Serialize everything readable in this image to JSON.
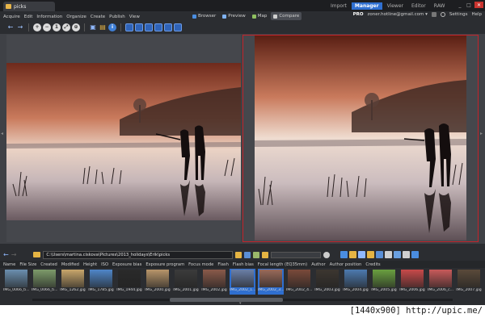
{
  "window": {
    "doc_tab": "picks",
    "modes": [
      "Import",
      "Manager",
      "Viewer",
      "Editor",
      "RAW"
    ],
    "active_mode": "Manager",
    "buttons": {
      "minimize": "_",
      "maximize": "□",
      "close": "✕"
    }
  },
  "menu": [
    "Acquire",
    "Edit",
    "Information",
    "Organize",
    "Create",
    "Publish",
    "View"
  ],
  "view_buttons": [
    {
      "label": "Browser",
      "icon": "browser-icon"
    },
    {
      "label": "Preview",
      "icon": "preview-icon"
    },
    {
      "label": "Map",
      "icon": "map-icon"
    },
    {
      "label": "Compare",
      "icon": "compare-icon",
      "active": true
    }
  ],
  "account": {
    "pro": "PRO",
    "email": "zoner.hotline@gmail.com ▾",
    "settings": "Settings",
    "help": "Help"
  },
  "path": {
    "current": "C:\\Users\\martina.ciskova\\Pictures\\2013_holidays\\Erik\\picks"
  },
  "columns": [
    "Name",
    "File Size",
    "Created",
    "Modified",
    "Height",
    "ISO",
    "Exposure bias",
    "Exposure program",
    "Focus mode",
    "Flash",
    "Flash bias",
    "Focal length (EQ35mm)",
    "Author",
    "Author position",
    "Credits"
  ],
  "thumbnails": [
    {
      "label": "IMG_0066_ti...",
      "color": "#6b8fb0"
    },
    {
      "label": "IMG_0066_ti...",
      "color": "#7d9b6a"
    },
    {
      "label": "IMG_1262.jpg",
      "color": "#c9a66b"
    },
    {
      "label": "IMG_1785.jpg",
      "color": "#4f86c9"
    },
    {
      "label": "IMG_1944.jpg",
      "color": "#2a2a2a"
    },
    {
      "label": "IMG_2000.jpg",
      "color": "#b8956a"
    },
    {
      "label": "IMG_2001.jpg",
      "color": "#3b3b3b"
    },
    {
      "label": "IMG_2002.jpg",
      "color": "#8a5a4a"
    },
    {
      "label": "IMG_2002_1...",
      "color": "#6a7fa8",
      "selected": true
    },
    {
      "label": "IMG_2002_3...",
      "color": "#9a6a5a",
      "selected": true
    },
    {
      "label": "IMG_2002_4...",
      "color": "#7a4a3a"
    },
    {
      "label": "IMG_2003.jpg",
      "color": "#3c3630"
    },
    {
      "label": "IMG_2004.jpg",
      "color": "#4d7ab0"
    },
    {
      "label": "IMG_2005.jpg",
      "color": "#6aa040"
    },
    {
      "label": "IMG_2006.jpg",
      "color": "#c84a4a"
    },
    {
      "label": "IMG_2006_c...",
      "color": "#c85a5a"
    },
    {
      "label": "IMG_2007.jpg",
      "color": "#5a4a3a"
    }
  ],
  "caption": "[1440x900] http://upic.me/"
}
